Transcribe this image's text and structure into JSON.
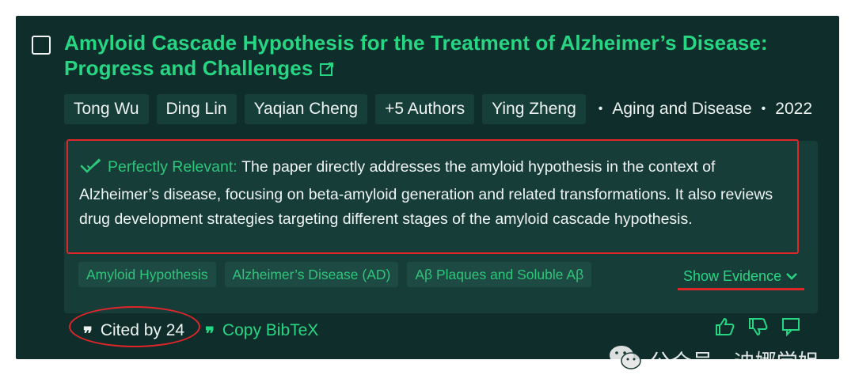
{
  "paper": {
    "title": "Amyloid Cascade Hypothesis for the Treatment of Alzheimer’s Disease: Progress and Challenges",
    "authors": [
      "Tong Wu",
      "Ding Lin",
      "Yaqian Cheng"
    ],
    "more_authors": "+5 Authors",
    "last_author": "Ying Zheng",
    "journal": "Aging and Disease",
    "year": "2022"
  },
  "relevance": {
    "label": "Perfectly Relevant:",
    "text": "The paper directly addresses the amyloid hypothesis in the context of Alzheimer’s disease, focusing on beta-amyloid generation and related transformations. It also reviews drug development strategies targeting different stages of the amyloid cascade hypothesis."
  },
  "tags": [
    "Amyloid Hypothesis",
    "Alzheimer’s Disease (AD)",
    "Aβ Plaques and Soluble Aβ"
  ],
  "show_evidence_label": "Show Evidence",
  "cited_by": "Cited by 24",
  "copy_bibtex": "Copy BibTeX",
  "watermark": "公众号 · 迪娜学姐",
  "icons": {
    "external_link": "external-link-icon",
    "relevance": "check-badge-icon",
    "chevron": "chevron-down-icon",
    "quote": "quote-icon",
    "thumbs_up": "thumbs-up-icon",
    "thumbs_down": "thumbs-down-icon",
    "comment": "comment-icon",
    "wechat": "wechat-icon"
  },
  "colors": {
    "card_bg": "#0f2e2b",
    "accent_green": "#27d683",
    "annotation_red": "#e0252b"
  }
}
